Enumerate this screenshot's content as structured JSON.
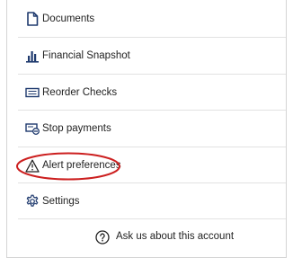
{
  "menu": {
    "items": [
      {
        "label": "Documents",
        "icon": "document-icon"
      },
      {
        "label": "Financial Snapshot",
        "icon": "bar-chart-icon"
      },
      {
        "label": "Reorder Checks",
        "icon": "check-icon"
      },
      {
        "label": "Stop payments",
        "icon": "stop-payment-icon"
      },
      {
        "label": "Alert preferences",
        "icon": "warning-icon"
      },
      {
        "label": "Settings",
        "icon": "gear-icon"
      }
    ]
  },
  "footer": {
    "ask_label": "Ask us about this account",
    "icon": "help-circle-icon"
  },
  "colors": {
    "text": "#222222",
    "accent_icon": "#1f3a6e",
    "highlight": "#cc1f1f",
    "divider": "#e2e2e2"
  }
}
